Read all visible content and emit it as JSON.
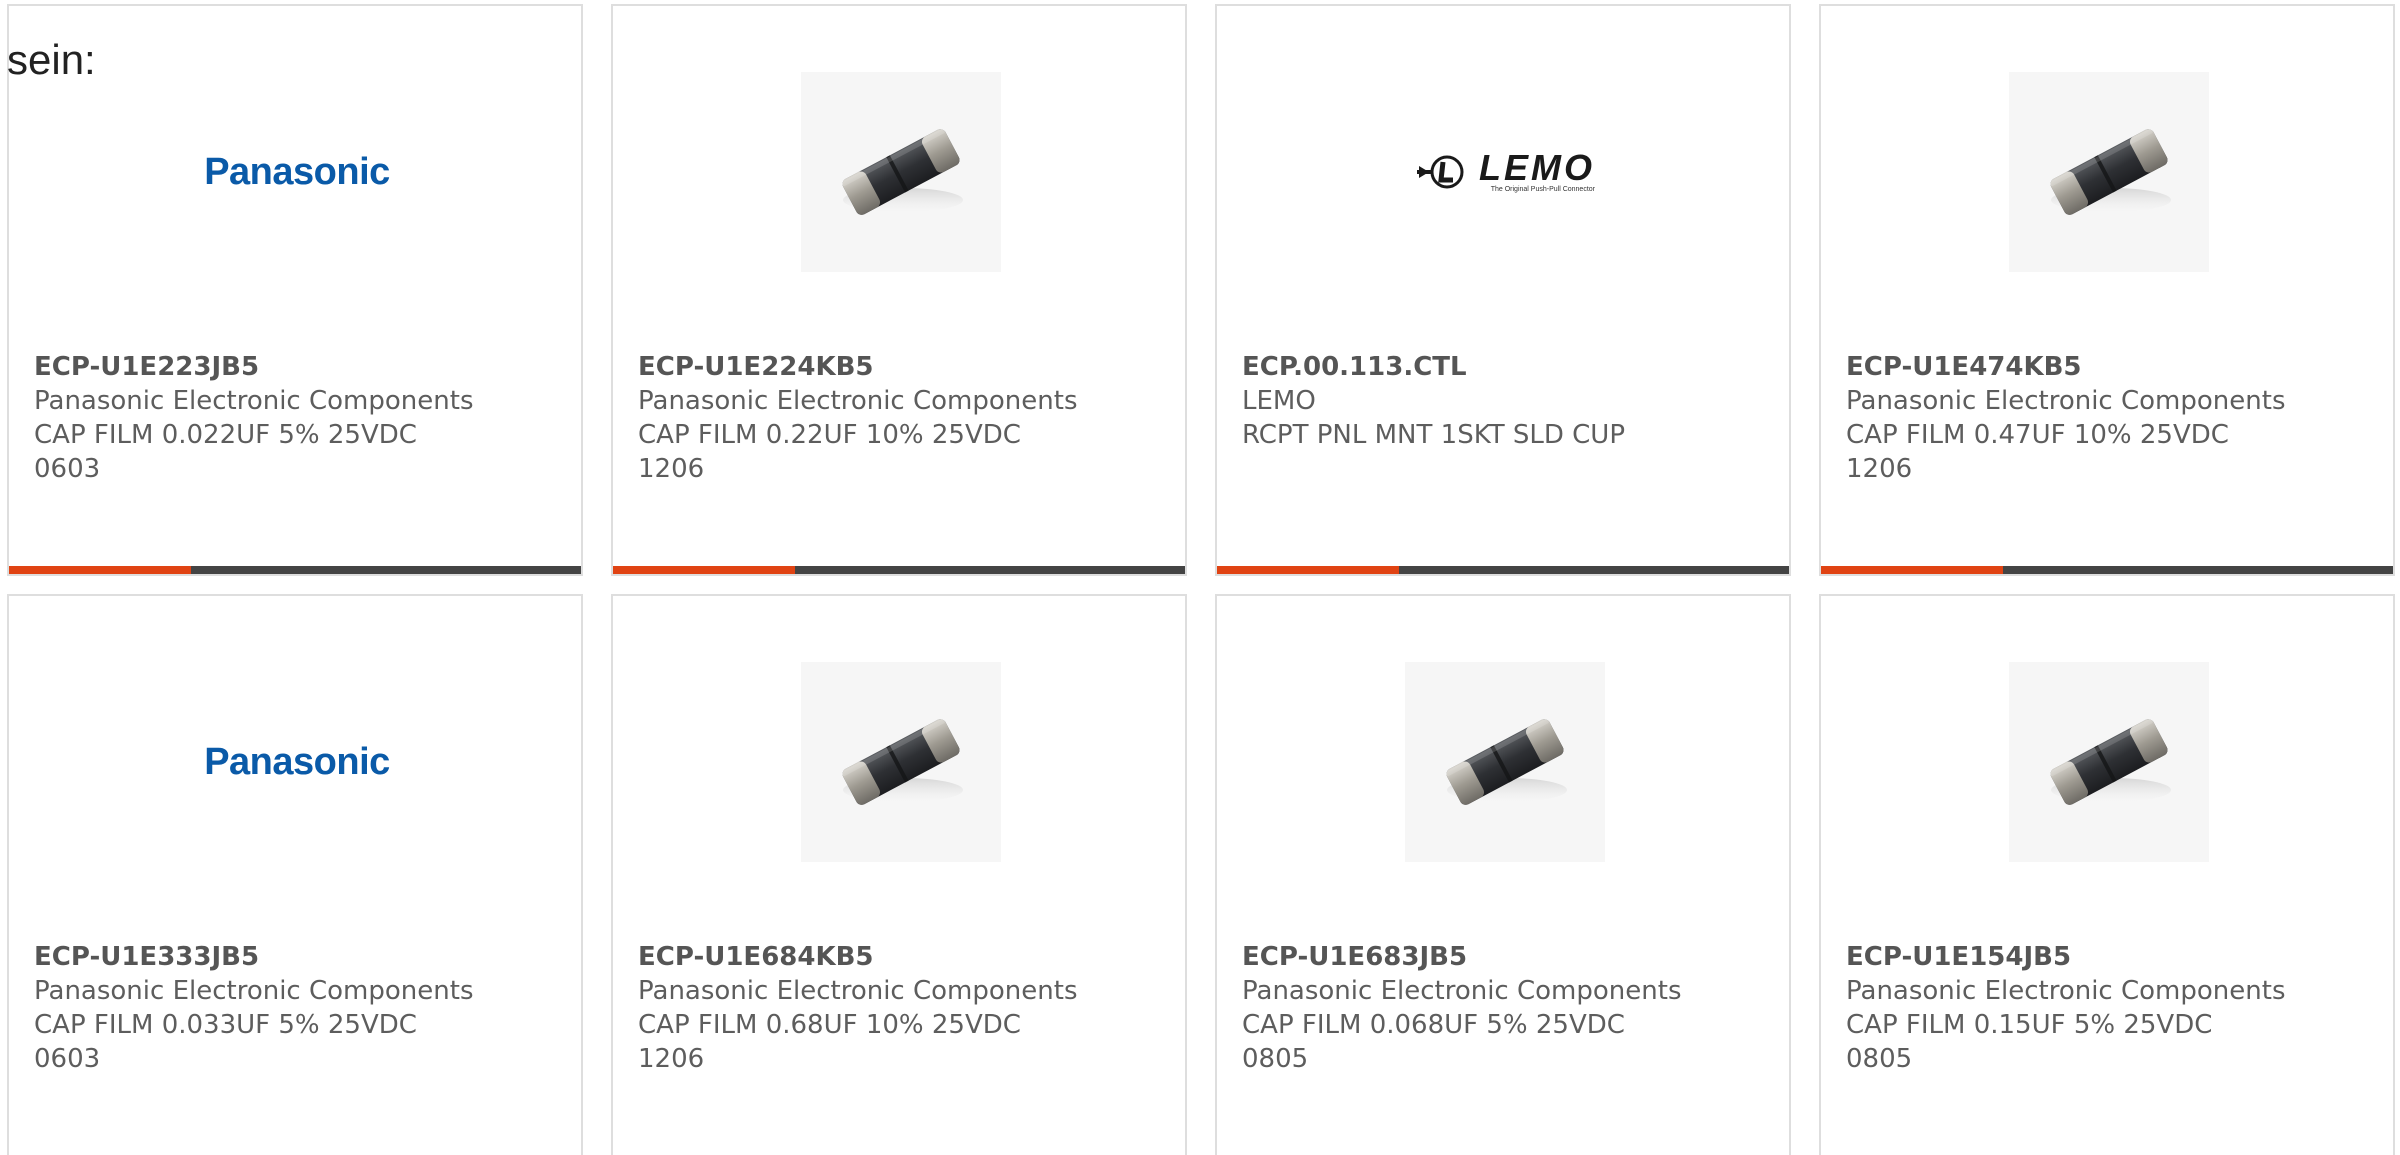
{
  "intro_text": "sein:",
  "colors": {
    "accent": "#e04313",
    "bar_dark": "#444444",
    "panasonic_blue": "#0a5aa8"
  },
  "cards": [
    {
      "part_number": "ECP-U1E223JB5",
      "manufacturer": "Panasonic Electronic Components",
      "description": "CAP FILM 0.022UF 5% 25VDC",
      "package": "0603",
      "image": "panasonic-logo",
      "logo_text": "Panasonic"
    },
    {
      "part_number": "ECP-U1E224KB5",
      "manufacturer": "Panasonic Electronic Components",
      "description": "CAP FILM 0.22UF 10% 25VDC",
      "package": "1206",
      "image": "smd-capacitor-photo"
    },
    {
      "part_number": "ECP.00.113.CTL",
      "manufacturer": "LEMO",
      "description": "RCPT PNL MNT 1SKT SLD CUP",
      "package": "",
      "image": "lemo-logo",
      "logo_text": "LEMO",
      "logo_tagline": "The Original Push-Pull Connector"
    },
    {
      "part_number": "ECP-U1E474KB5",
      "manufacturer": "Panasonic Electronic Components",
      "description": "CAP FILM 0.47UF 10% 25VDC",
      "package": "1206",
      "image": "smd-capacitor-photo"
    },
    {
      "part_number": "ECP-U1E333JB5",
      "manufacturer": "Panasonic Electronic Components",
      "description": "CAP FILM 0.033UF 5% 25VDC",
      "package": "0603",
      "image": "panasonic-logo",
      "logo_text": "Panasonic"
    },
    {
      "part_number": "ECP-U1E684KB5",
      "manufacturer": "Panasonic Electronic Components",
      "description": "CAP FILM 0.68UF 10% 25VDC",
      "package": "1206",
      "image": "smd-capacitor-photo"
    },
    {
      "part_number": "ECP-U1E683JB5",
      "manufacturer": "Panasonic Electronic Components",
      "description": "CAP FILM 0.068UF 5% 25VDC",
      "package": "0805",
      "image": "smd-capacitor-photo"
    },
    {
      "part_number": "ECP-U1E154JB5",
      "manufacturer": "Panasonic Electronic Components",
      "description": "CAP FILM 0.15UF 5% 25VDC",
      "package": "0805",
      "image": "smd-capacitor-photo"
    }
  ]
}
